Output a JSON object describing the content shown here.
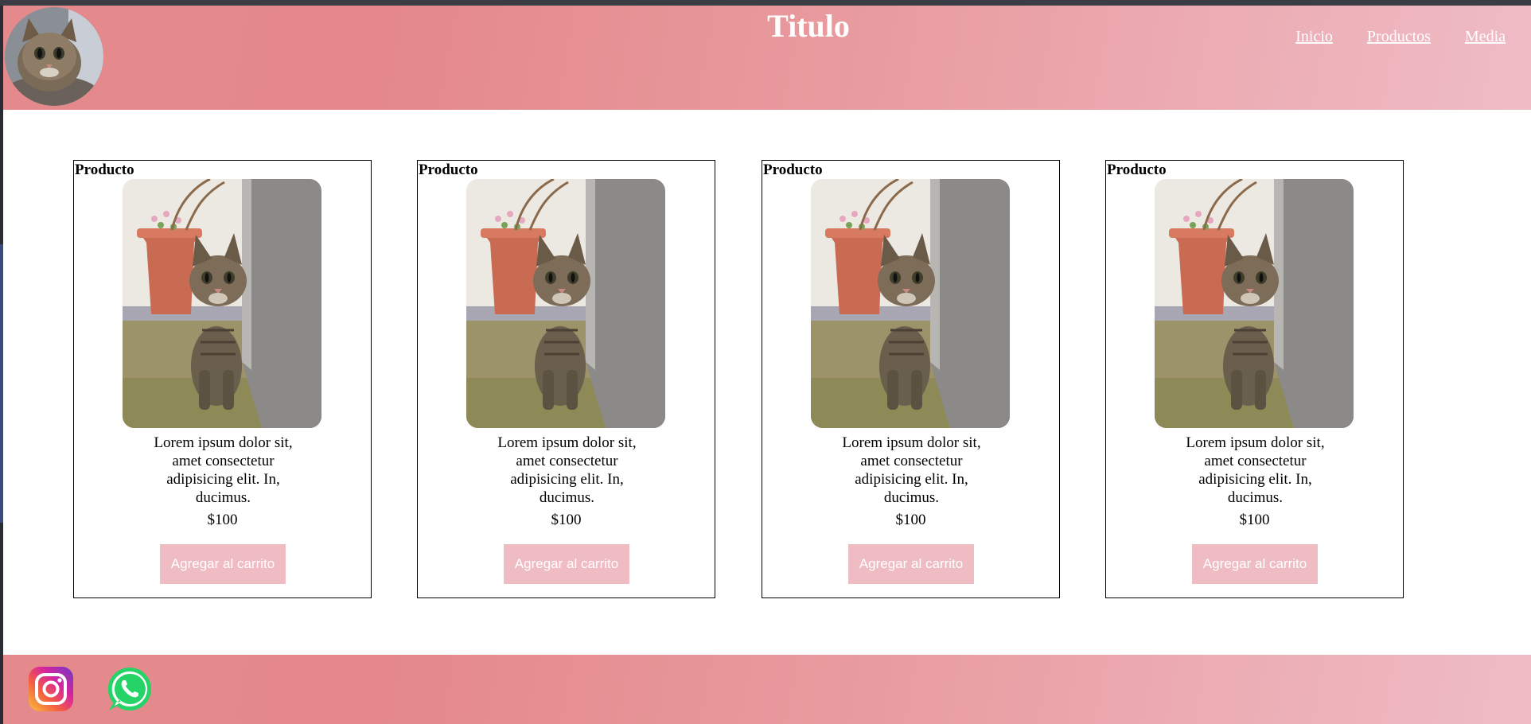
{
  "header": {
    "title": "Titulo",
    "nav": [
      "Inicio",
      "Productos",
      "Media"
    ]
  },
  "products": [
    {
      "title": "Producto",
      "description": "Lorem ipsum dolor sit, amet consectetur adipisicing elit. In, ducimus.",
      "price": "$100",
      "button": "Agregar al carrito"
    },
    {
      "title": "Producto",
      "description": "Lorem ipsum dolor sit, amet consectetur adipisicing elit. In, ducimus.",
      "price": "$100",
      "button": "Agregar al carrito"
    },
    {
      "title": "Producto",
      "description": "Lorem ipsum dolor sit, amet consectetur adipisicing elit. In, ducimus.",
      "price": "$100",
      "button": "Agregar al carrito"
    },
    {
      "title": "Producto",
      "description": "Lorem ipsum dolor sit, amet consectetur adipisicing elit. In, ducimus.",
      "price": "$100",
      "button": "Agregar al carrito"
    }
  ],
  "footer": {
    "icons": [
      "instagram-icon",
      "whatsapp-icon"
    ]
  },
  "colors": {
    "header_gradient": [
      "#e48a8c",
      "#efbcc6"
    ],
    "button_bg": "#f0bcc3",
    "text_light": "#ffffff"
  }
}
